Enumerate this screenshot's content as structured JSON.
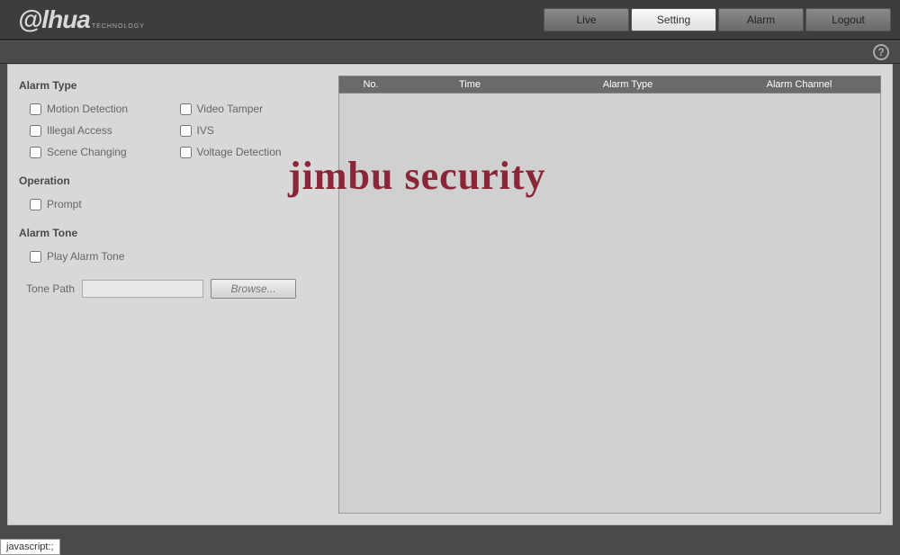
{
  "logo": {
    "main": "@lhua",
    "sub": "TECHNOLOGY"
  },
  "nav": {
    "live": "Live",
    "setting": "Setting",
    "alarm": "Alarm",
    "logout": "Logout"
  },
  "help_icon": "?",
  "sections": {
    "alarm_type": "Alarm Type",
    "operation": "Operation",
    "alarm_tone": "Alarm Tone"
  },
  "checkboxes": {
    "motion_detection": "Motion Detection",
    "video_tamper": "Video Tamper",
    "illegal_access": "Illegal Access",
    "ivs": "IVS",
    "scene_changing": "Scene Changing",
    "voltage_detection": "Voltage Detection",
    "prompt": "Prompt",
    "play_alarm_tone": "Play Alarm Tone"
  },
  "tone_path": {
    "label": "Tone Path",
    "value": "",
    "browse": "Browse..."
  },
  "table": {
    "headers": {
      "no": "No.",
      "time": "Time",
      "type": "Alarm Type",
      "channel": "Alarm Channel"
    },
    "rows": []
  },
  "watermark": "jimbu security",
  "status": "javascript:;"
}
